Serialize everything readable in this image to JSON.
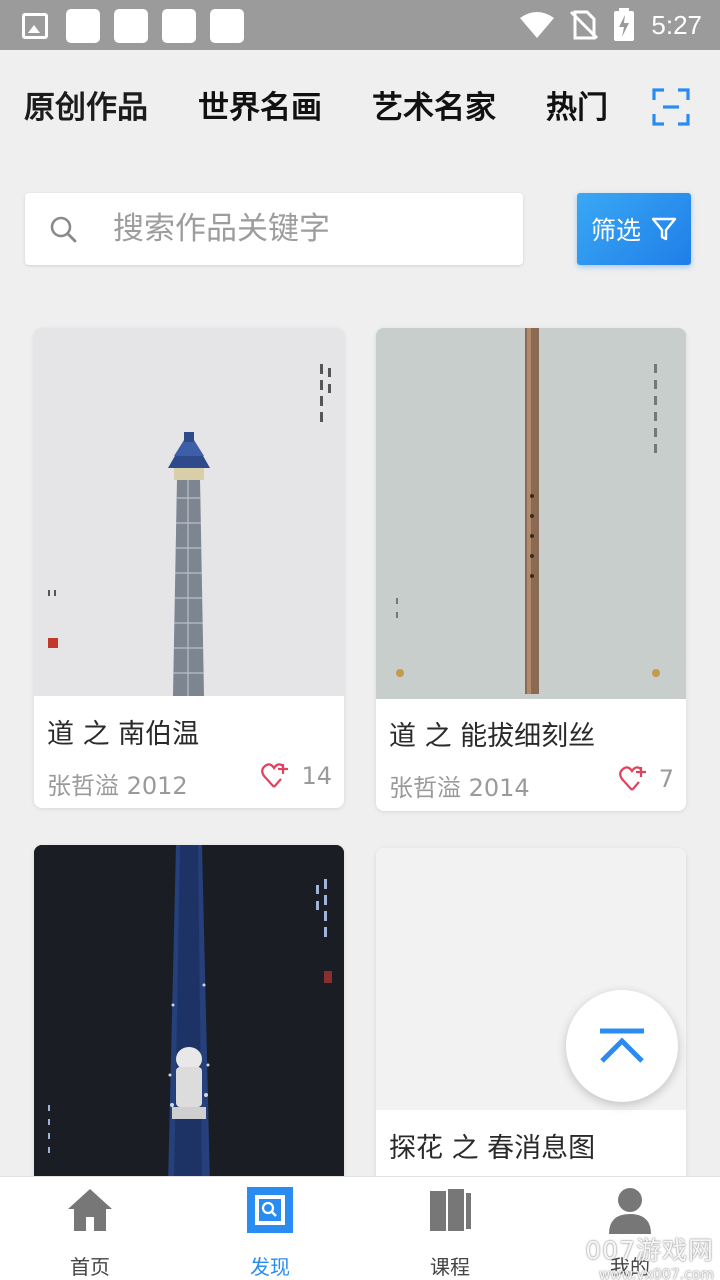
{
  "status_bar": {
    "time": "5:27"
  },
  "tabs": [
    {
      "label": "原创作品",
      "active": true
    },
    {
      "label": "世界名画",
      "active": false
    },
    {
      "label": "艺术名家",
      "active": false
    },
    {
      "label": "热门",
      "active": false
    }
  ],
  "search": {
    "placeholder": "搜索作品关键字",
    "value": ""
  },
  "filter": {
    "label": "筛选"
  },
  "artworks": [
    {
      "title": "道 之 南伯温",
      "meta": "张哲溢 2012",
      "likes": "14"
    },
    {
      "title": "道 之 能拔细刻丝",
      "meta": "张哲溢 2014",
      "likes": "7"
    },
    {
      "title": "",
      "meta": "",
      "likes": ""
    },
    {
      "title": "探花 之 春消息图",
      "meta": "",
      "likes": ""
    }
  ],
  "bottom_nav": [
    {
      "label": "首页",
      "icon": "home-icon"
    },
    {
      "label": "发现",
      "icon": "discover-icon",
      "active": true
    },
    {
      "label": "课程",
      "icon": "book-icon"
    },
    {
      "label": "我的",
      "icon": "user-icon"
    }
  ],
  "watermark": {
    "brand": "007游戏网",
    "url": "www.yx007.com"
  },
  "colors": {
    "accent": "#2a8cf0",
    "filter_gradient_start": "#3aa8f4",
    "filter_gradient_end": "#1f7ee8",
    "heart": "#e0435c"
  }
}
